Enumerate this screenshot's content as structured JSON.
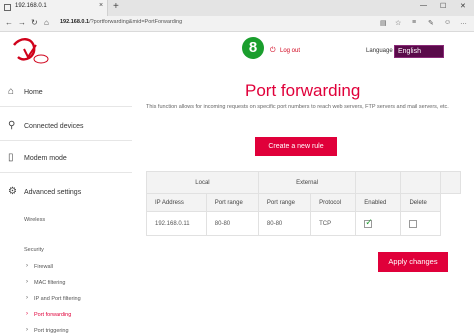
{
  "browser": {
    "tab_title": "192.168.0.1",
    "tab_close": "×",
    "new_tab": "+",
    "url_host": "192.168.0.1",
    "url_path": "/?portforwarding&mid=PortForwarding",
    "win_minimize": "—",
    "win_maximize": "☐",
    "win_close": "✕"
  },
  "header": {
    "badge": "8",
    "logout_label": "Log out",
    "language_label": "Language",
    "language_value": "English"
  },
  "sidebar": {
    "items": [
      {
        "label": "Home",
        "icon": "home-icon"
      },
      {
        "label": "Connected devices",
        "icon": "devices-icon"
      },
      {
        "label": "Modem mode",
        "icon": "modem-icon"
      },
      {
        "label": "Advanced settings",
        "icon": "gear-icon"
      }
    ],
    "wireless": "Wireless",
    "security": "Security",
    "security_items": [
      "Firewall",
      "MAC filtering",
      "IP and Port filtering",
      "Port forwarding",
      "Port triggering"
    ]
  },
  "main": {
    "title": "Port forwarding",
    "intro": "This function allows for incoming requests on specific port numbers to reach web servers, FTP servers and mail servers, etc.",
    "create_button": "Create a new rule",
    "apply_button": "Apply changes",
    "table": {
      "group_local": "Local",
      "group_external": "External",
      "col_ip": "IP Address",
      "col_local_range": "Port range",
      "col_ext_range": "Port range",
      "col_protocol": "Protocol",
      "col_enabled": "Enabled",
      "col_delete": "Delete",
      "rows": [
        {
          "ip": "192.168.0.11",
          "local_range": "80-80",
          "ext_range": "80-80",
          "protocol": "TCP",
          "enabled": true,
          "delete": false
        }
      ]
    }
  },
  "colors": {
    "accent": "#e0003a",
    "lang_bg": "#5a0a4a",
    "badge": "#1a9e2d"
  }
}
